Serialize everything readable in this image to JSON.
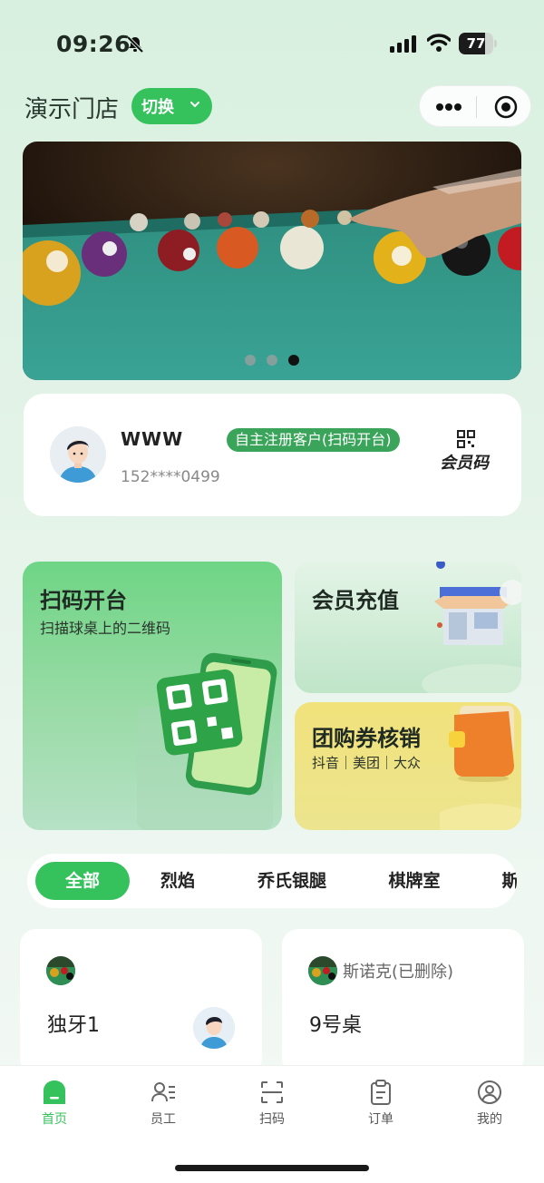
{
  "status_bar": {
    "time": "09:26",
    "battery": "77",
    "battery_level": 0.77
  },
  "header": {
    "store_name": "演示门店",
    "switch_label": "切换"
  },
  "banner": {
    "slide_count": 3,
    "active_slide": 3
  },
  "member": {
    "name": "WWW",
    "phone": "152****0499",
    "tag": "自主注册客户(扫码开台)",
    "code_label": "会员码"
  },
  "features": {
    "scan": {
      "title": "扫码开台",
      "subtitle": "扫描球桌上的二维码"
    },
    "recharge": {
      "title": "会员充值"
    },
    "coupon": {
      "title": "团购券核销",
      "subtitle": "抖音｜美团｜大众"
    }
  },
  "categories": [
    "全部",
    "烈焰",
    "乔氏银腿",
    "棋牌室",
    "斯"
  ],
  "tables": [
    {
      "name": "独牙1",
      "status": ""
    },
    {
      "name": "9号桌",
      "status": "斯诺克(已删除)"
    }
  ],
  "tabbar": [
    "首页",
    "员工",
    "扫码",
    "订单",
    "我的"
  ],
  "colors": {
    "accent": "#35c15c",
    "tag": "#3aa55a",
    "coupon_tile": "#f1e27b"
  }
}
